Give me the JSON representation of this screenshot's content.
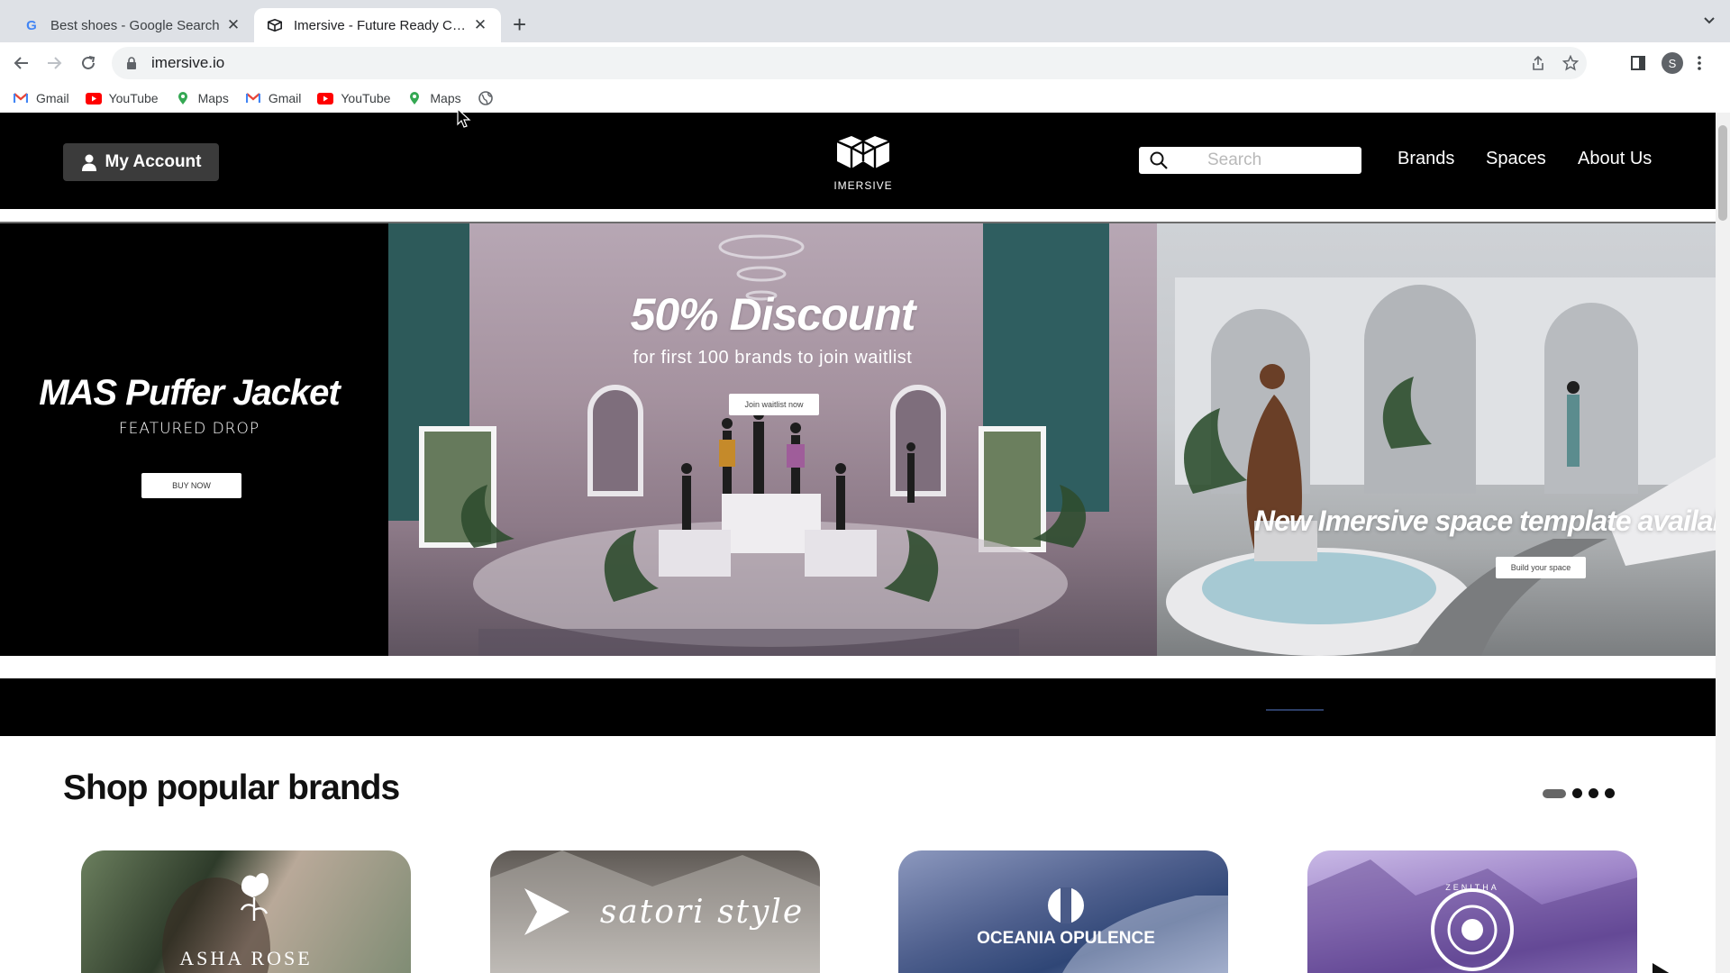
{
  "browser": {
    "tabs": [
      {
        "title": "Best shoes - Google Search",
        "favicon": "google-icon",
        "active": false
      },
      {
        "title": "Imersive - Future Ready Cons...",
        "favicon": "imersive-icon",
        "active": true
      }
    ],
    "url": "imersive.io",
    "profile_initial": "S",
    "bookmarks": [
      {
        "label": "Gmail",
        "icon": "gmail-icon"
      },
      {
        "label": "YouTube",
        "icon": "youtube-icon"
      },
      {
        "label": "Maps",
        "icon": "maps-icon"
      },
      {
        "label": "Gmail",
        "icon": "gmail-icon"
      },
      {
        "label": "YouTube",
        "icon": "youtube-icon"
      },
      {
        "label": "Maps",
        "icon": "maps-icon"
      }
    ]
  },
  "header": {
    "account_label": "My Account",
    "logo_text": "IMERSIVE",
    "search_placeholder": "Search",
    "nav": [
      "Brands",
      "Spaces",
      "About Us"
    ]
  },
  "hero": {
    "slides": [
      {
        "title": "MAS Puffer Jacket",
        "subtitle": "FEATURED DROP",
        "button": "BUY NOW"
      },
      {
        "title": "50% Discount",
        "subtitle": "for first 100 brands to join waitlist",
        "button": "Join waitlist now"
      },
      {
        "title": "New Imersive space template availabl",
        "button": "Build your space"
      }
    ]
  },
  "popular_brands": {
    "title": "Shop popular brands",
    "brands": [
      "ASHA ROSE",
      "satori style",
      "OCEANIA OPULENCE",
      "ZENITHA"
    ]
  },
  "colors": {
    "header_bg": "#000000",
    "account_btn": "#3b3b3b",
    "tabstrip": "#dee1e6"
  }
}
